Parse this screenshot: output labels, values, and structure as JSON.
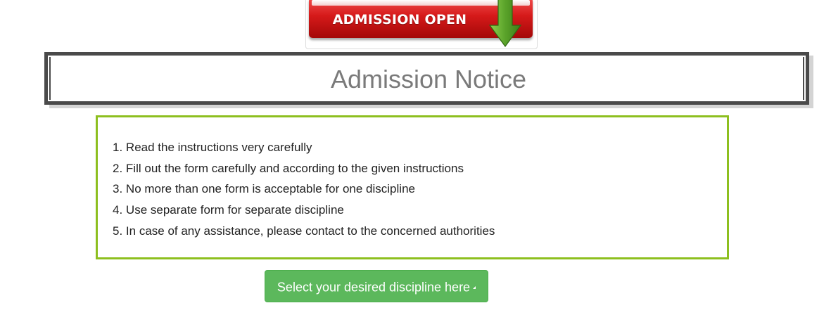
{
  "banner": {
    "text": "ADMISSION OPEN",
    "arrow_icon": "down-arrow-icon",
    "colors": {
      "ribbon": "#d61a1a",
      "arrow": "#5aa32a"
    }
  },
  "title": {
    "text": "Admission Notice",
    "color": "#7a7a7a",
    "border_color": "#4a4a4a"
  },
  "instructions": {
    "border_color": "#8dbf1f",
    "items": [
      {
        "num": "1.",
        "text": "Read the instructions very carefully"
      },
      {
        "num": "2.",
        "text": "Fill out the form carefully and according to the given instructions"
      },
      {
        "num": "3.",
        "text": "No more than one form is acceptable for one discipline"
      },
      {
        "num": "4.",
        "text": "Use separate form for separate discipline"
      },
      {
        "num": "5.",
        "text": "In case of any assistance, please contact to the concerned authorities"
      }
    ]
  },
  "discipline_button": {
    "label": "Select your desired discipline here",
    "icon": "caret-icon",
    "color": "#5cb85c"
  }
}
